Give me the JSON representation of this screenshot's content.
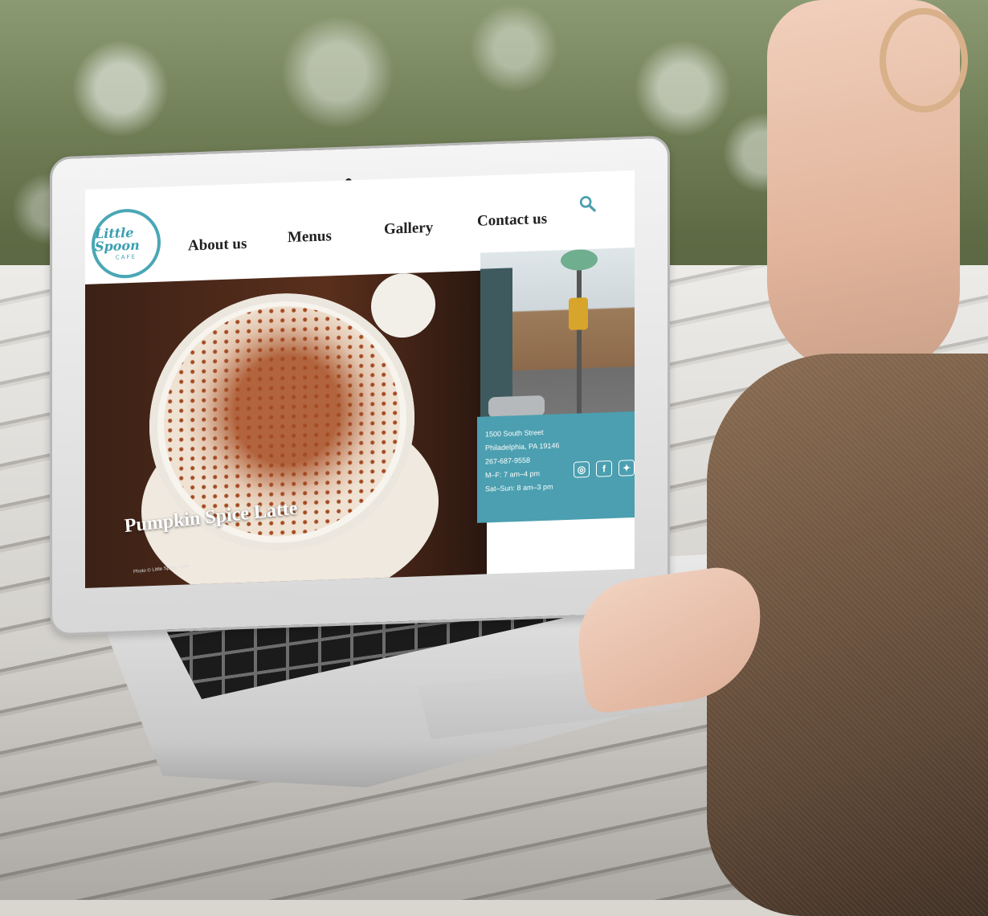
{
  "site": {
    "logo": {
      "script": "Little Spoon",
      "sub": "CAFE"
    },
    "nav": {
      "about": "About us",
      "menus": "Menus",
      "gallery": "Gallery",
      "contact": "Contact us"
    },
    "hero": {
      "caption": "Pumpkin Spice Latte",
      "credit": "Photo © Little Spoon Cafe"
    },
    "info": {
      "address1": "1500 South Street",
      "address2": "Philadelphia, PA 19146",
      "phone": "267-687-9558",
      "hours_weekday": "M–F: 7 am–4 pm",
      "hours_weekend": "Sat–Sun: 8 am–3 pm"
    },
    "social": [
      "instagram-icon",
      "facebook-icon",
      "twitter-icon"
    ],
    "accent_color": "#4b9fb0"
  }
}
